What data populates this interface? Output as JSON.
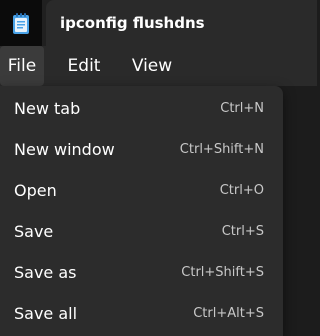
{
  "tab": {
    "title": "ipconfig flushdns",
    "icon": "notepad-icon"
  },
  "menubar": {
    "file": "File",
    "edit": "Edit",
    "view": "View"
  },
  "file_menu": {
    "items": [
      {
        "label": "New tab",
        "shortcut": "Ctrl+N"
      },
      {
        "label": "New window",
        "shortcut": "Ctrl+Shift+N"
      },
      {
        "label": "Open",
        "shortcut": "Ctrl+O"
      },
      {
        "label": "Save",
        "shortcut": "Ctrl+S"
      },
      {
        "label": "Save as",
        "shortcut": "Ctrl+Shift+S"
      },
      {
        "label": "Save all",
        "shortcut": "Ctrl+Alt+S"
      }
    ]
  },
  "colors": {
    "titlebar": "#202020",
    "tab": "#2a2a2a",
    "menu_background": "#2c2c2c",
    "file_highlight": "#3b3b3b",
    "icon_accent": "#4aa3e8"
  }
}
